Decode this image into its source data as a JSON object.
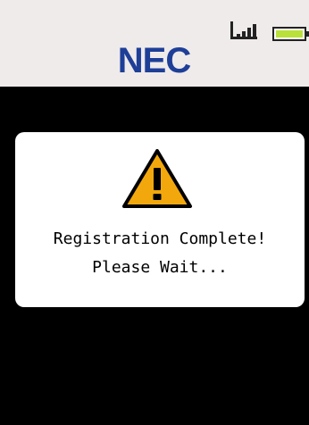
{
  "header": {
    "brand": "NEC",
    "signal_icon": "signal-strength-icon",
    "battery_icon": "battery-icon",
    "colors": {
      "background": "#efebea",
      "brand": "#1e3f98",
      "battery_fill": "#b9e13a"
    }
  },
  "dialog": {
    "icon": "warning-triangle-icon",
    "line1": "Registration Complete!",
    "line2": "Please Wait...",
    "colors": {
      "icon_fill": "#f2a80d",
      "background": "#ffffff"
    }
  }
}
